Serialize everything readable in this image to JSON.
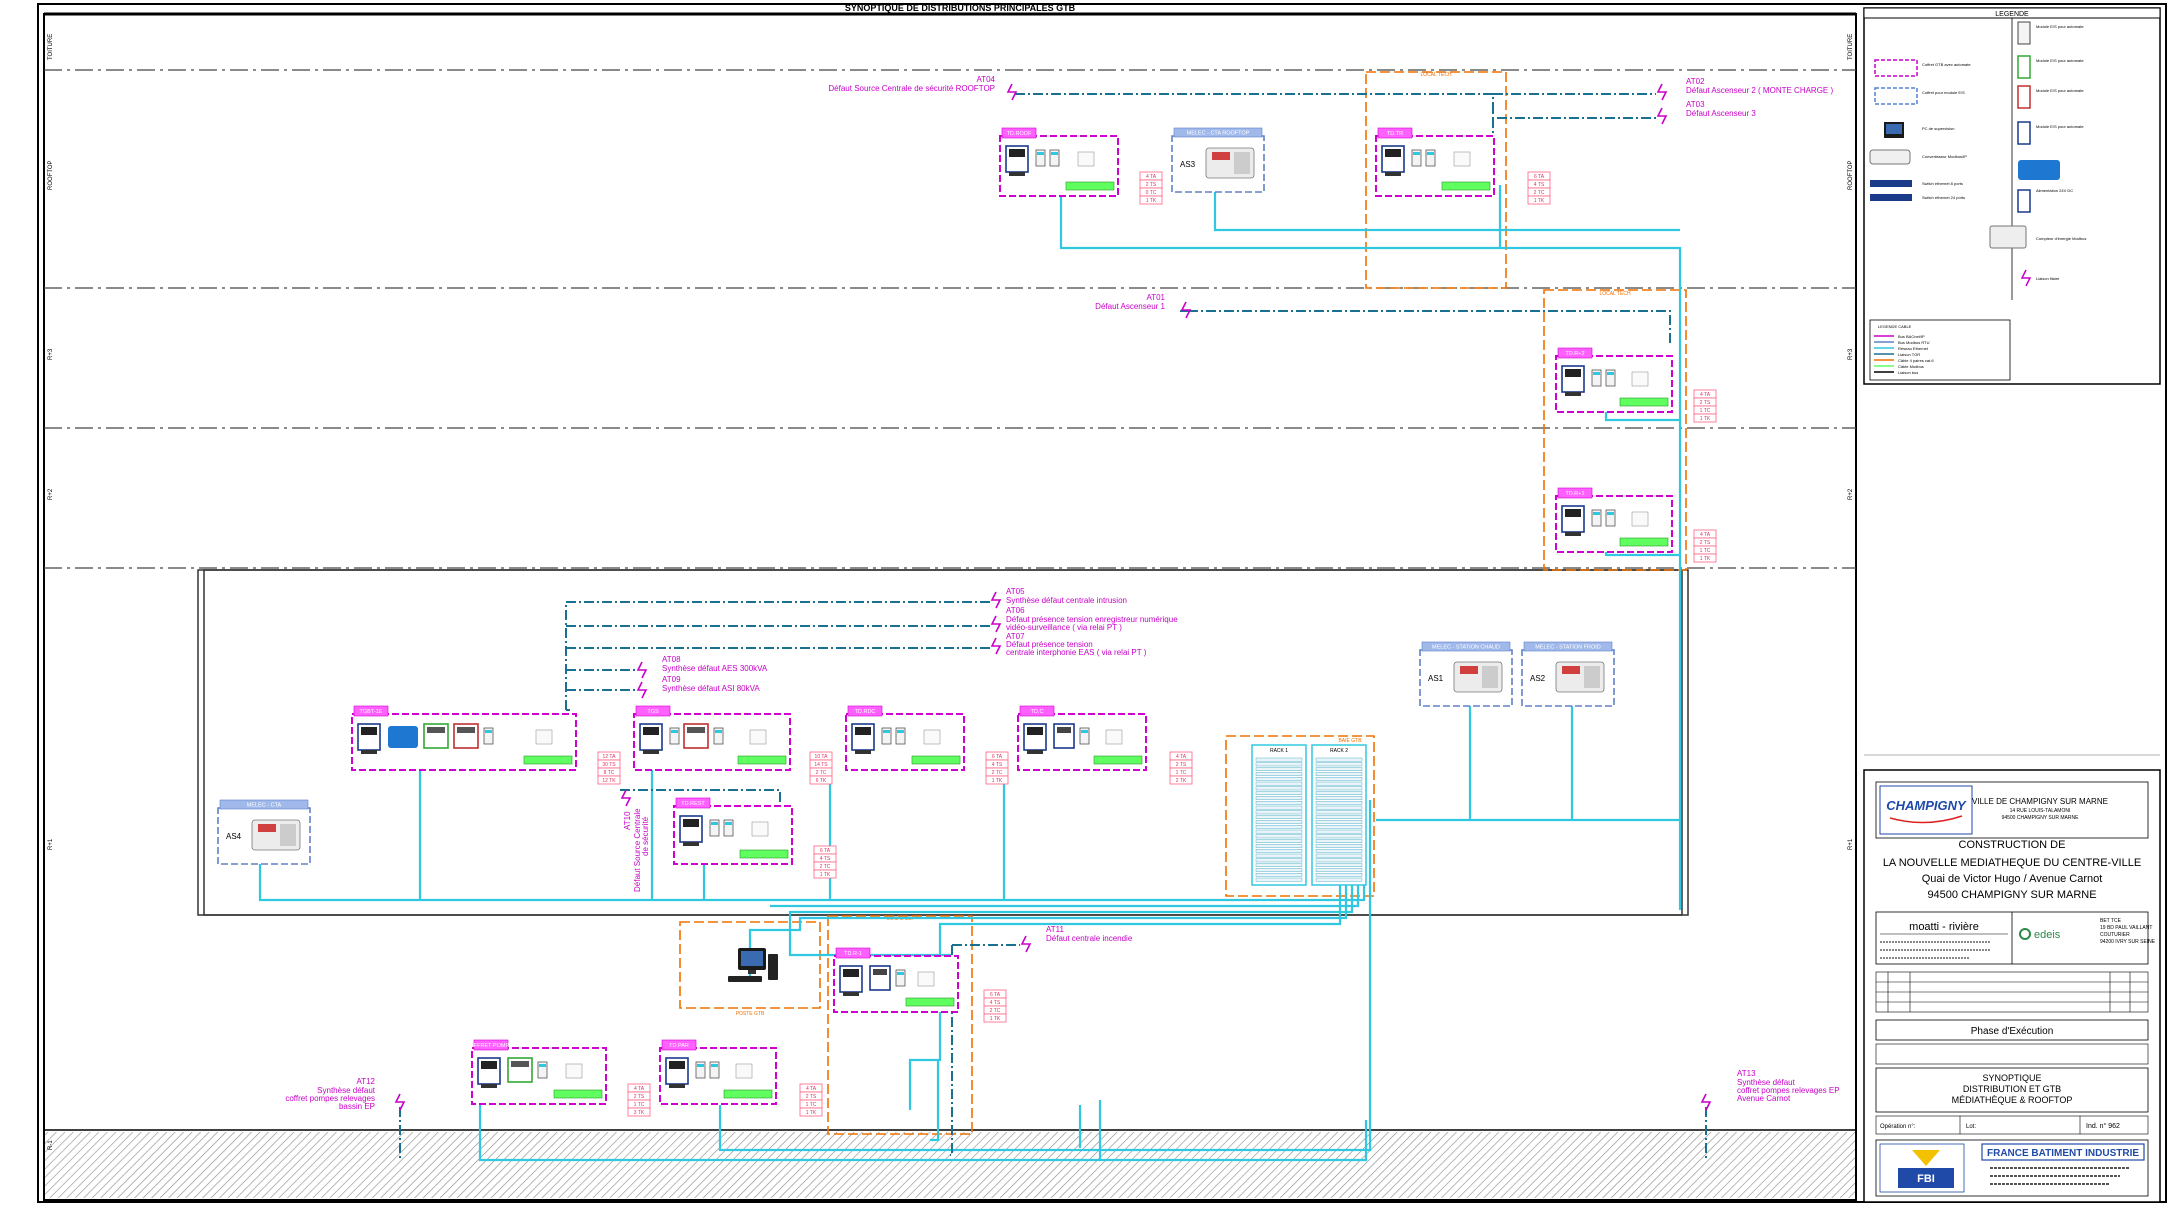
{
  "drawing": {
    "title": "SYNOPTIQUE DE DISTRIBUTIONS PRINCIPALES GTB",
    "level_labels": [
      "TOITURE",
      "ROOFTOP",
      "R+3",
      "R+2",
      "R+1",
      "RDC",
      "R-1"
    ]
  },
  "alarms": [
    {
      "code": "AT04",
      "lines": [
        "Défaut Source Centrale de sécurité ROOFTOP"
      ]
    },
    {
      "code": "AT02",
      "lines": [
        "Défaut Ascenseur 2 ( MONTE CHARGE )"
      ]
    },
    {
      "code": "AT03",
      "lines": [
        "Défaut Ascenseur 3"
      ]
    },
    {
      "code": "AT01",
      "lines": [
        "Défaut Ascenseur 1"
      ]
    },
    {
      "code": "AT05",
      "lines": [
        "Synthèse défaut centrale intrusion"
      ]
    },
    {
      "code": "AT06",
      "lines": [
        "Défaut présence tension enregistreur numérique",
        "vidéo-surveillance ( via relai PT )"
      ]
    },
    {
      "code": "AT07",
      "lines": [
        "Défaut présence tension",
        "centrale interphonie EAS ( via relai PT )"
      ]
    },
    {
      "code": "AT08",
      "lines": [
        "Synthèse défaut AES 300kVA"
      ]
    },
    {
      "code": "AT09",
      "lines": [
        "Synthèse défaut ASI 80kVA"
      ]
    },
    {
      "code": "AT10",
      "lines": [
        "Défaut Source Centrale",
        "de sécurité"
      ]
    },
    {
      "code": "AT11",
      "lines": [
        "Défaut centrale incendie"
      ]
    },
    {
      "code": "AT12",
      "lines": [
        "Synthèse défaut",
        "coffret pompes relevages",
        "bassin EP"
      ]
    },
    {
      "code": "AT13",
      "lines": [
        "Synthèse défaut",
        "coffret pompes relevages EP",
        "Avenue Carnot"
      ]
    }
  ],
  "panels": [
    {
      "name": "TD.ROOF"
    },
    {
      "name": "TD.TR"
    },
    {
      "name": "TD.R+2"
    },
    {
      "name": "TD.R+1"
    },
    {
      "name": "TGBT-1E"
    },
    {
      "name": "TGS"
    },
    {
      "name": "TD.RDC"
    },
    {
      "name": "TD.C"
    },
    {
      "name": "TD.REST"
    },
    {
      "name": "TD.R-1"
    },
    {
      "name": "COFFRET POMPES"
    },
    {
      "name": "TD.PAR"
    }
  ],
  "meters": [
    {
      "code": "AS3",
      "label": "MELEC - CTA ROOFTOP"
    },
    {
      "code": "AS1",
      "label": "MELEC - STATION CHAUD"
    },
    {
      "code": "AS2",
      "label": "MELEC - STATION FROID"
    },
    {
      "code": "AS4",
      "label": "MELEC - CTA"
    }
  ],
  "io_tags": {
    "roof": [
      "4 TA",
      "2 TS",
      "0 TC",
      "1 TK"
    ],
    "tr": [
      "6 TA",
      "4 TS",
      "2 TC",
      "1 TK"
    ],
    "r2": [
      "4 TA",
      "2 TS",
      "1 TC",
      "1 TK"
    ],
    "r1": [
      "4 TA",
      "2 TS",
      "1 TC",
      "1 TK"
    ],
    "tgbt": [
      "12 TA",
      "30 TS",
      "8 TC",
      "12 TK"
    ],
    "tgs": [
      "10 TA",
      "14 TS",
      "2 TC",
      "6 TK"
    ],
    "rdc": [
      "6 TA",
      "4 TS",
      "2 TC",
      "1 TK"
    ],
    "tdc": [
      "4 TA",
      "2 TS",
      "1 TC",
      "2 TK"
    ],
    "rest": [
      "6 TA",
      "4 TS",
      "2 TC",
      "1 TK"
    ],
    "r_1": [
      "6 TA",
      "4 TS",
      "2 TC",
      "1 TK"
    ],
    "pompes": [
      "4 TA",
      "2 TS",
      "1 TC",
      "3 TK"
    ],
    "par": [
      "4 TA",
      "2 TS",
      "1 TC",
      "1 TK"
    ]
  },
  "zones": {
    "local_tech": "LOCAL TECH",
    "baie": "BAIE",
    "ssi": "LOCAL SSI",
    "poste": "POSTE GTB",
    "baie_label": "BAIE GTB",
    "bay_labels": [
      "RACK 1",
      "RACK 2"
    ]
  },
  "legend": {
    "title": "LEGENDE",
    "items": [
      "Module E/S pour automate",
      "Coffret GTB avec automate",
      "Coffret pour module E/S",
      "PC de supervision",
      "Convertisseur Modbus/IP",
      "Switch ethernet 8 ports",
      "Switch ethernet 24 ports",
      "Compteur d'énergie Modbus",
      "Alimentation 24V DC",
      "Liaison filaire"
    ],
    "cable_title": "LEGENDE CABLE",
    "cables": [
      "Bus BACnet/IP",
      "Bus Modbus RTU",
      "Réseau Ethernet",
      "Liaison TOR",
      "Câble 4 paires cat.6",
      "Câble Modbus",
      "Liaison bus"
    ]
  },
  "title_block": {
    "client_logo": "CHAMPIGNY",
    "client": [
      "VILLE DE CHAMPIGNY SUR MARNE",
      "14 RUE LOUIS-TALAMONI",
      "94500 CHAMPIGNY SUR MARNE"
    ],
    "project": [
      "CONSTRUCTION DE",
      "LA NOUVELLE MEDIATHEQUE DU CENTRE-VILLE",
      "Quai de Victor Hugo / Avenue Carnot",
      "94500 CHAMPIGNY SUR MARNE"
    ],
    "architect": "moatti - rivière",
    "bet_logo": "edeis",
    "bet": [
      "BET TCE",
      "19 BD PAUL VAILLANT",
      "COUTURIER",
      "94200 IVRY SUR SEINE"
    ],
    "phase": "Phase d'Exécution",
    "drawing_title": [
      "SYNOPTIQUE",
      "DISTRIBUTION ET GTB",
      "MÉDIATHÈQUE & ROOFTOP"
    ],
    "operation_label": "Opération n°:",
    "lot_label": "Lot:",
    "doc_number": "Ind. n° 962",
    "company": "FRANCE BATIMENT INDUSTRIE",
    "company_logo": "FBI"
  }
}
